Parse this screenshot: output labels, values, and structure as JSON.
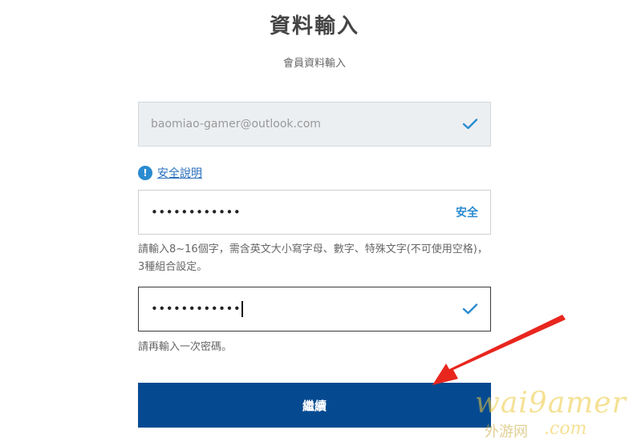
{
  "header": {
    "title": "資料輸入",
    "subtitle": "會員資料輸入"
  },
  "email_field": {
    "value": "baomiao-gamer@outlook.com",
    "status_icon": "check-icon",
    "disabled": true
  },
  "security_info": {
    "icon": "!",
    "link_label": "安全說明"
  },
  "password_field": {
    "value": "••••••••••••",
    "strength_label": "安全"
  },
  "password_hint": "請輸入8~16個字，需含英文大小寫字母、數字、特殊文字(不可使用空格)，3種組合設定。",
  "confirm_field": {
    "value": "••••••••••••",
    "status_icon": "check-icon"
  },
  "confirm_hint": "請再輸入一次密碼。",
  "continue_button": {
    "label": "繼續"
  },
  "watermark": {
    "main": "wai9amer",
    "sub": "外游网",
    "com": ".com"
  },
  "colors": {
    "accent_blue": "#2a8bd0",
    "button_blue": "#054a91",
    "arrow_red": "#e8261e"
  }
}
